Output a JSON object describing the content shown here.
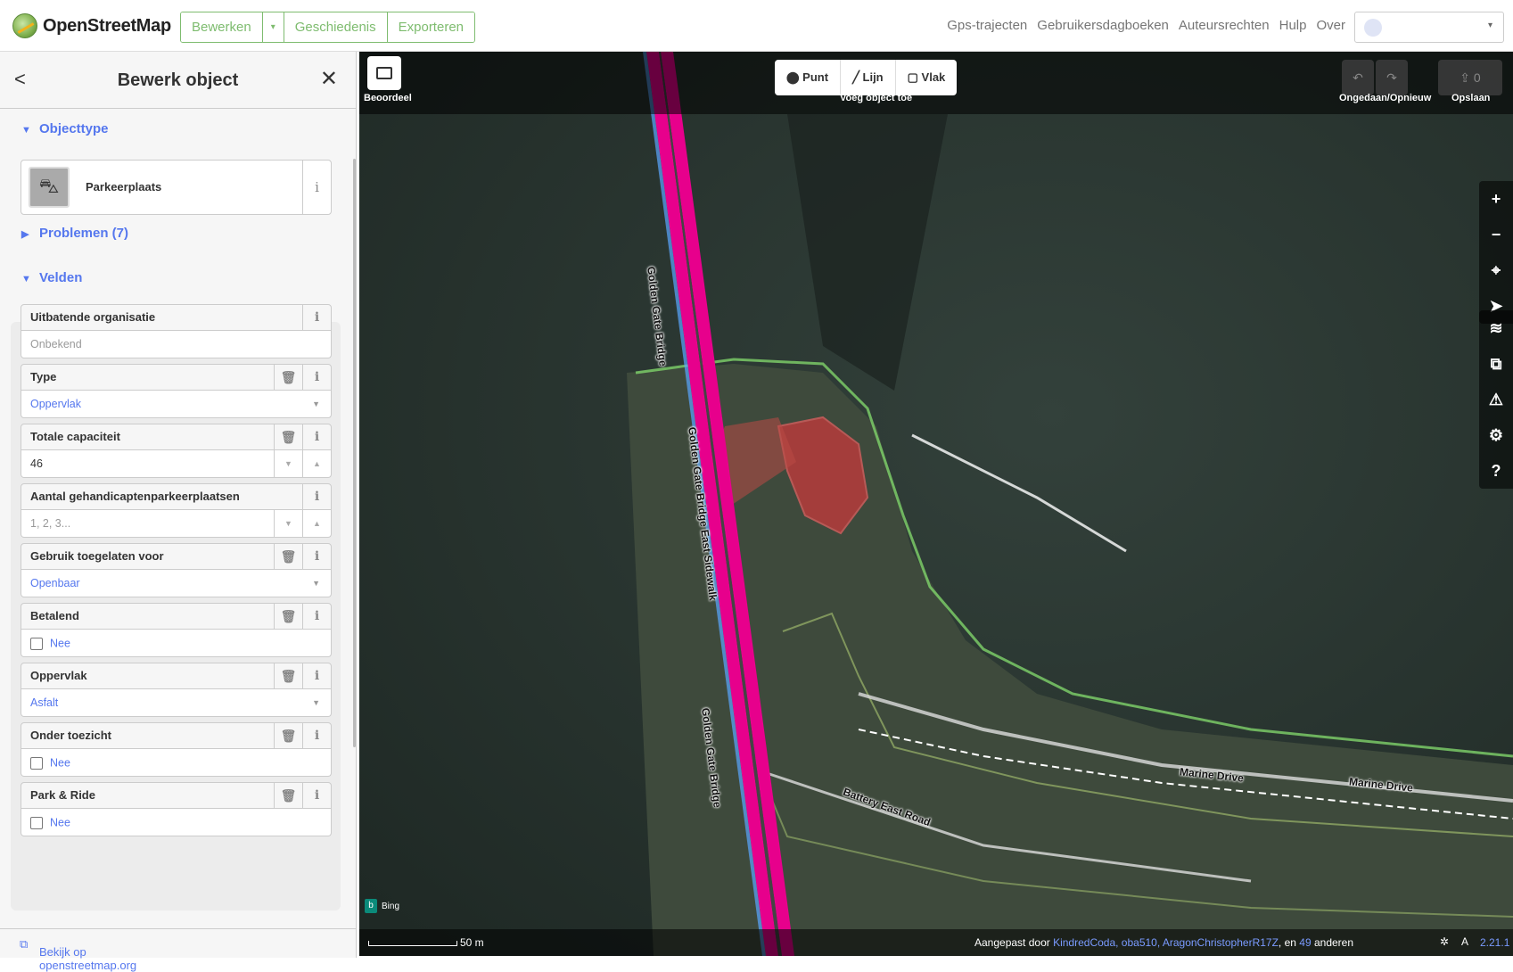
{
  "header": {
    "logo_text": "OpenStreetMap",
    "edit_label": "Bewerken",
    "edit_dropdown": "▾",
    "history_label": "Geschiedenis",
    "export_label": "Exporteren",
    "nav": [
      "Gps-trajecten",
      "Gebruikersdagboeken",
      "Auteursrechten",
      "Hulp",
      "Over"
    ],
    "user_caret": "▾"
  },
  "sidebar": {
    "back_icon": "<",
    "title": "Bewerk object",
    "close_icon": "✕",
    "objecttype_heading": "Objecttype",
    "preset_label": "Parkeerplaats",
    "preset_icon": "car-icon",
    "problems_heading": "Problemen (7)",
    "fields_heading": "Velden",
    "fields": [
      {
        "label": "Uitbatende organisatie",
        "value": "Onbekend"
      },
      {
        "label": "Type",
        "value": "Oppervlak"
      },
      {
        "label": "Totale capaciteit",
        "value": "46"
      },
      {
        "label": "Aantal gehandicaptenparkeerplaatsen",
        "value": "1, 2, 3..."
      },
      {
        "label": "Gebruik toegelaten voor",
        "value": "Openbaar"
      },
      {
        "label": "Betalend",
        "value": "Nee"
      },
      {
        "label": "Oppervlak",
        "value": "Asfalt"
      },
      {
        "label": "Onder toezicht",
        "value": "Nee"
      },
      {
        "label": "Park & Ride",
        "value": "Nee"
      }
    ],
    "footer_link": "Bekijk op openstreetmap.org",
    "info_glyph": "i",
    "trash_glyph": "🗑"
  },
  "map": {
    "review_label": "Beoordeel",
    "tools": [
      "Punt",
      "Lijn",
      "Vlak"
    ],
    "add_feature_label": "Voeg object toe",
    "undo_redo_label": "Ongedaan/Opnieuw",
    "save_label": "Opslaan",
    "save_count": "0",
    "road_labels": {
      "ggb_north": "Golden Gate Bridge",
      "ggb_east_sidewalk": "Golden Gate Bridge East Sidewalk",
      "ggb_south": "Golden Gate Bridge",
      "marine_drive_1": "Marine Drive",
      "marine_drive_2": "Marine Drive",
      "battery_east": "Battery East Road"
    },
    "imagery": "Bing",
    "scale_label": "50 m",
    "attribution": {
      "prefix": "Aangepast door",
      "users": "KindredCoda, oba510, AragonChristopherR17Z",
      "middle": ", en",
      "count": "49",
      "suffix": "anderen"
    },
    "version": "2.21.1",
    "colors": {
      "bridge": "#e7008c",
      "parking_fill": "#c6393b",
      "park_green": "#7fd36a",
      "accent_blue": "#5577ee",
      "osm_green": "#7ebc6f"
    }
  }
}
